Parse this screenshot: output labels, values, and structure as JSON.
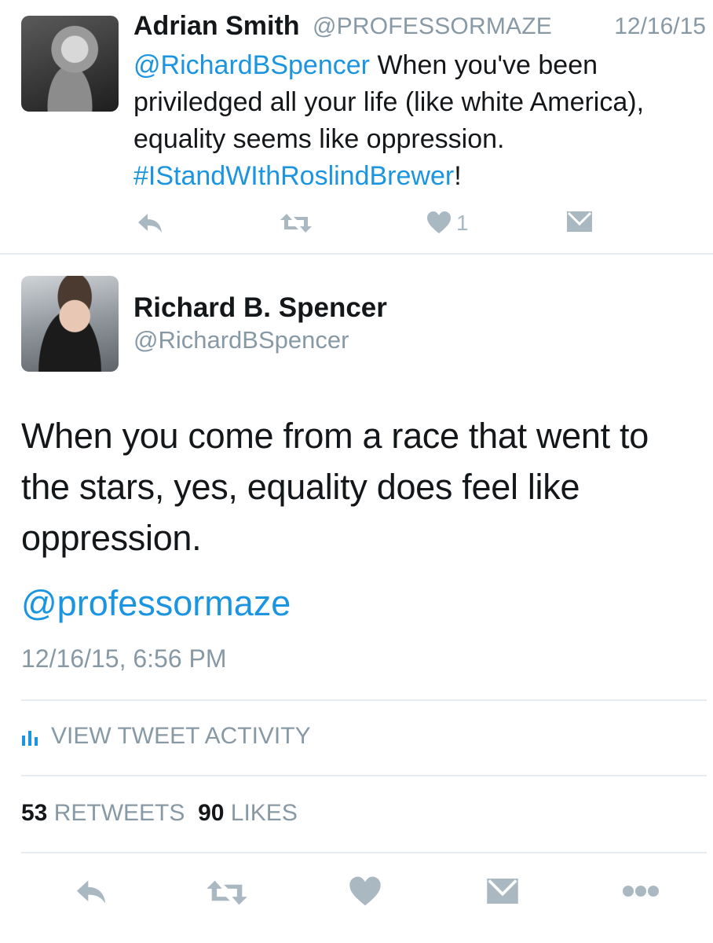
{
  "reply_tweet": {
    "author_name": "Adrian Smith",
    "author_handle": "@PROFESSORMAZE",
    "date": "12/16/15",
    "text_mention": "@RichardBSpencer",
    "text_body": " When you've been priviledged all your life (like white America), equality seems like oppression. ",
    "text_hashtag": "#IStandWIthRoslindBrewer",
    "text_end": "!",
    "like_count": "1",
    "icons": [
      "reply-icon",
      "retweet-icon",
      "heart-icon",
      "direct-message-icon"
    ]
  },
  "main_tweet": {
    "author_name": "Richard B. Spencer",
    "author_handle": "@RichardBSpencer",
    "text": "When you come from a race that went to the stars, yes, equality does feel like oppression.",
    "mention": "@professormaze",
    "timestamp": "12/16/15, 6:56 PM",
    "activity_label": "VIEW TWEET ACTIVITY",
    "retweet_count": "53",
    "retweet_label": "RETWEETS",
    "like_count": "90",
    "like_label": "LIKES",
    "icons": [
      "reply-icon",
      "retweet-icon",
      "heart-icon",
      "direct-message-icon",
      "more-icon"
    ]
  },
  "colors": {
    "link": "#1b95e0",
    "icon_gray": "#aab8c2",
    "muted_text": "#8899a6",
    "divider": "#e6ecf0"
  }
}
